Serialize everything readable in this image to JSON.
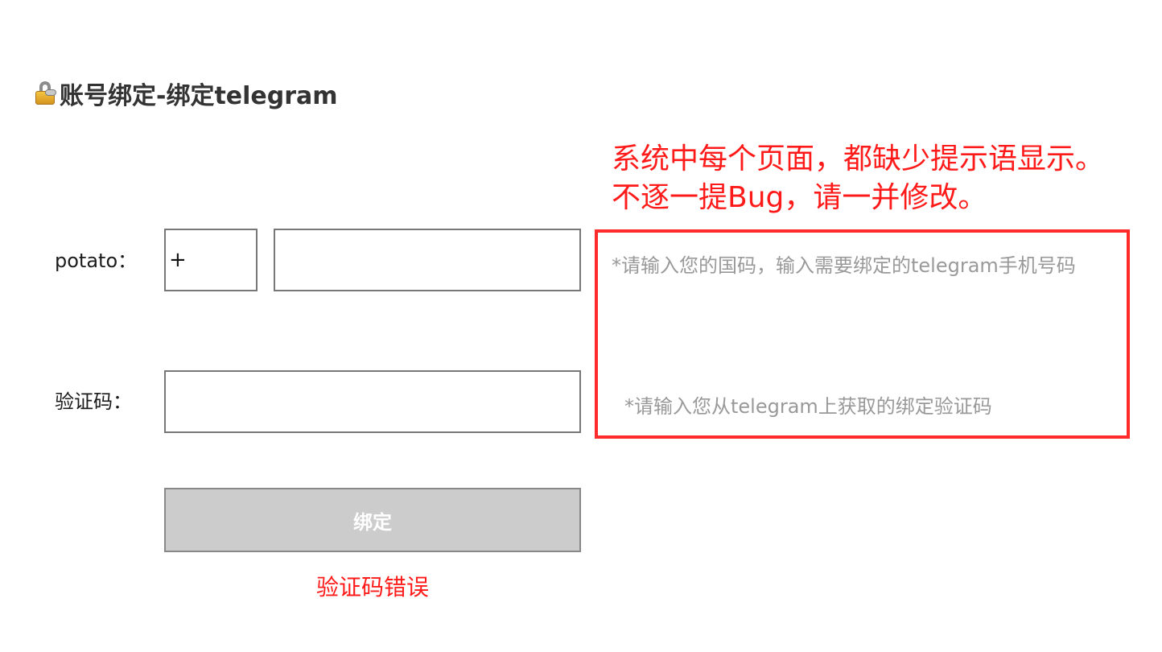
{
  "header": {
    "title": "账号绑定-绑定telegram",
    "icon": "lock-with-key-icon"
  },
  "annotation": {
    "text": "系统中每个页面，都缺少提示语显示。不逐一提Bug，请一并修改。",
    "color": "#ff1a1a"
  },
  "form": {
    "phone_label": "potato：",
    "country_code_value": "+",
    "phone_value": "",
    "code_label": "验证码：",
    "code_value": ""
  },
  "hints": {
    "phone_hint": "*请输入您的国码，输入需要绑定的telegram手机号码",
    "code_hint": "*请输入您从telegram上获取的绑定验证码",
    "border_color": "#ff2a2a"
  },
  "actions": {
    "bind_label": "绑定",
    "error_message": "验证码错误"
  }
}
